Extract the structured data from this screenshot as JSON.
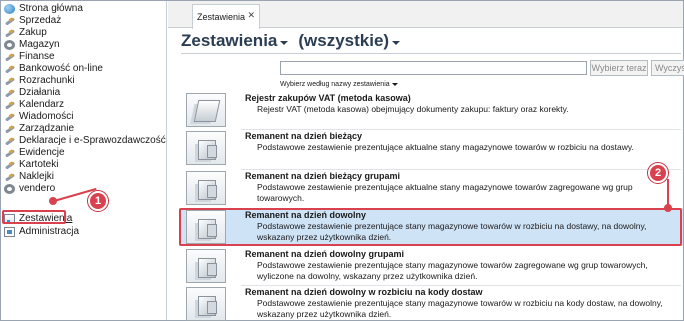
{
  "sidebar": {
    "items": [
      {
        "label": "Strona główna",
        "icon": "home-globe-icon"
      },
      {
        "label": "Sprzedaż",
        "icon": "quill-icon"
      },
      {
        "label": "Zakup",
        "icon": "quill-icon"
      },
      {
        "label": "Magazyn",
        "icon": "warehouse-icon"
      },
      {
        "label": "Finanse",
        "icon": "quill-icon"
      },
      {
        "label": "Bankowość on-line",
        "icon": "quill-icon"
      },
      {
        "label": "Rozrachunki",
        "icon": "quill-icon"
      },
      {
        "label": "Działania",
        "icon": "quill-icon"
      },
      {
        "label": "Kalendarz",
        "icon": "quill-icon"
      },
      {
        "label": "Wiadomości",
        "icon": "quill-icon"
      },
      {
        "label": "Zarządzanie",
        "icon": "quill-icon"
      },
      {
        "label": "Deklaracje i e-Sprawozdawczość",
        "icon": "quill-icon"
      },
      {
        "label": "Ewidencje",
        "icon": "quill-icon"
      },
      {
        "label": "Kartoteki",
        "icon": "quill-icon"
      },
      {
        "label": "Naklejki",
        "icon": "quill-icon"
      },
      {
        "label": "vendero",
        "icon": "gear-icon"
      },
      {
        "label": "Zestawienia",
        "icon": "report-icon"
      },
      {
        "label": "Administracja",
        "icon": "admin-icon"
      }
    ],
    "selected": "Zestawienia"
  },
  "callouts": {
    "first": "1",
    "second": "2"
  },
  "tabs": [
    {
      "label": "Zestawienia",
      "close": "✕"
    }
  ],
  "header": {
    "title": "Zestawienia",
    "filter": "(wszystkie)"
  },
  "search": {
    "placeholder": "",
    "button_label": "Wybierz teraz",
    "clear_label": "Wyczyść"
  },
  "sort": {
    "label": "Wybierz według nazwy zestawienia"
  },
  "reports": [
    {
      "title": "Rejestr zakupów VAT (metoda kasowa)",
      "description": "Rejestr VAT (metoda kasowa) obejmujący dokumenty zakupu: faktury oraz korekty."
    },
    {
      "title": "Remanent na dzień bieżący",
      "description": "Podstawowe zestawienie prezentujące aktualne stany magazynowe towarów w rozbiciu na dostawy."
    },
    {
      "title": "Remanent na dzień bieżący grupami",
      "description": "Podstawowe zestawienie prezentujące aktualne stany magazynowe towarów zagregowane wg grup towarowych."
    },
    {
      "title": "Remanent na dzień dowolny",
      "description": "Podstawowe zestawienie prezentujące stany magazynowe towarów w rozbiciu na dostawy, na dowolny, wskazany przez użytkownika dzień."
    },
    {
      "title": "Remanent na dzień dowolny grupami",
      "description": "Podstawowe zestawienie prezentujące stany magazynowe towarów zagregowane wg grup towarowych, wyliczone na dowolny, wskazany przez użytkownika dzień."
    },
    {
      "title": "Remanent na dzień dowolny w rozbiciu na kody dostaw",
      "description": "Podstawowe zestawienie prezentujące stany magazynowe towarów w rozbiciu na kody dostaw, na dowolny, wskazany przez użytkownika dzień."
    }
  ],
  "colors": {
    "accent": "#2a3d52",
    "highlight": "#d9414e",
    "selection": "#cfe3f6"
  }
}
